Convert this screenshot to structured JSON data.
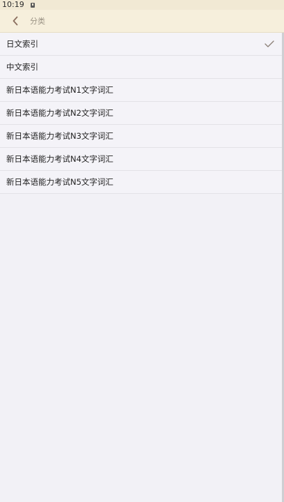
{
  "status_bar": {
    "time": "10:19",
    "notification_icon": "notification-icon"
  },
  "header": {
    "title": "分类",
    "back_icon": "chevron-left-icon"
  },
  "categories": {
    "items": [
      {
        "label": "日文索引",
        "selected": true
      },
      {
        "label": "中文索引",
        "selected": false
      },
      {
        "label": "新日本语能力考试N1文字词汇",
        "selected": false
      },
      {
        "label": "新日本语能力考试N2文字词汇",
        "selected": false
      },
      {
        "label": "新日本语能力考试N3文字词汇",
        "selected": false
      },
      {
        "label": "新日本语能力考试N4文字词汇",
        "selected": false
      },
      {
        "label": "新日本语能力考试N5文字词汇",
        "selected": false
      }
    ]
  },
  "colors": {
    "header_bg": "#f6efdc",
    "status_bg": "#f1e9d4",
    "page_bg": "#f2f1f6",
    "back_icon": "#8a6e5e",
    "check_icon": "#8a7e76"
  }
}
